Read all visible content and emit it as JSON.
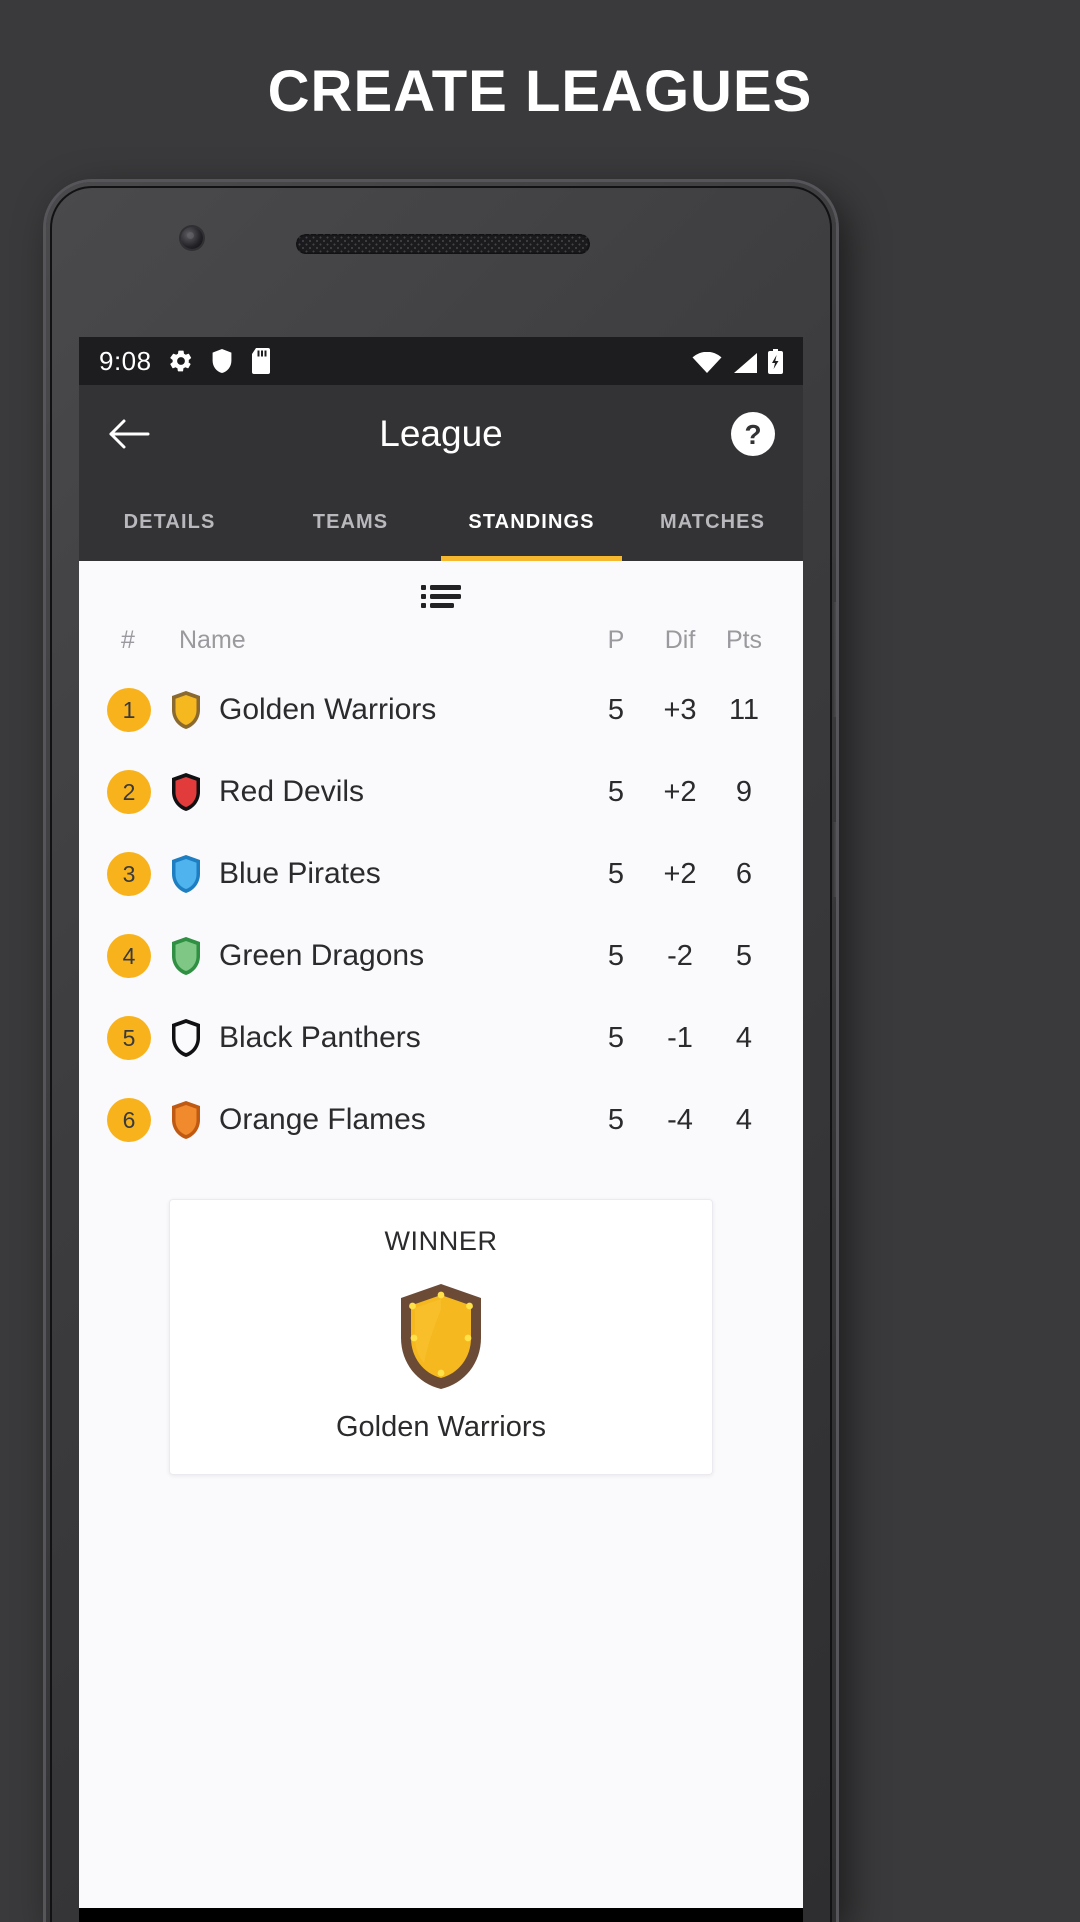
{
  "promo": {
    "headline": "CREATE LEAGUES"
  },
  "status_bar": {
    "time": "9:08",
    "left_icons": [
      "gear-icon",
      "shield-icon",
      "sd-card-icon"
    ],
    "right_icons": [
      "wifi-icon",
      "cellular-signal-icon",
      "battery-charging-icon"
    ]
  },
  "app_bar": {
    "back_icon": "back-arrow-icon",
    "title": "League",
    "help_icon": "help-circle-icon"
  },
  "tabs": {
    "items": [
      {
        "label": "DETAILS",
        "active": false
      },
      {
        "label": "TEAMS",
        "active": false
      },
      {
        "label": "STANDINGS",
        "active": true
      },
      {
        "label": "MATCHES",
        "active": false
      }
    ],
    "indicator_color": "#f5b82e"
  },
  "standings": {
    "list_toggle_icon": "list-view-icon",
    "headers": {
      "rank": "#",
      "name": "Name",
      "played": "P",
      "diff": "Dif",
      "points": "Pts"
    },
    "rows": [
      {
        "rank": "1",
        "name": "Golden Warriors",
        "played": "5",
        "diff": "+3",
        "points": "11",
        "crest_color": "#f5b81e",
        "crest_border": "#8a6a2e"
      },
      {
        "rank": "2",
        "name": "Red Devils",
        "played": "5",
        "diff": "+2",
        "points": "9",
        "crest_color": "#e23b3b",
        "crest_border": "#111114"
      },
      {
        "rank": "3",
        "name": "Blue Pirates",
        "played": "5",
        "diff": "+2",
        "points": "6",
        "crest_color": "#4fb3ee",
        "crest_border": "#1e7ec2"
      },
      {
        "rank": "4",
        "name": "Green Dragons",
        "played": "5",
        "diff": "-2",
        "points": "5",
        "crest_color": "#7ec784",
        "crest_border": "#2f8f42"
      },
      {
        "rank": "5",
        "name": "Black Panthers",
        "played": "5",
        "diff": "-1",
        "points": "4",
        "crest_color": "#fbfbfd",
        "crest_border": "#111114"
      },
      {
        "rank": "6",
        "name": "Orange Flames",
        "played": "5",
        "diff": "-4",
        "points": "4",
        "crest_color": "#f08a2c",
        "crest_border": "#c05a12"
      }
    ],
    "rank_badge_color": "#f8b31c"
  },
  "winner_card": {
    "label": "WINNER",
    "trophy_icon": "gold-shield-icon",
    "team": "Golden Warriors"
  }
}
